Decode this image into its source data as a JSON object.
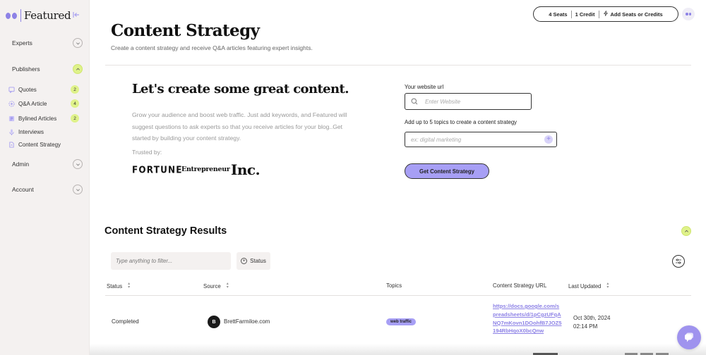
{
  "sidebar": {
    "brand": "Featured",
    "sections": [
      {
        "label": "Experts",
        "expanded": false
      },
      {
        "label": "Publishers",
        "expanded": true
      },
      {
        "label": "Admin",
        "expanded": false
      },
      {
        "label": "Account",
        "expanded": false
      }
    ],
    "publisher_items": [
      {
        "label": "Quotes",
        "icon": "quote-bubble-icon",
        "badge": "2"
      },
      {
        "label": "Q&A Article",
        "icon": "plus-circle-icon",
        "badge": "4"
      },
      {
        "label": "Bylined Articles",
        "icon": "article-icon",
        "badge": "2"
      },
      {
        "label": "Interviews",
        "icon": "microphone-icon",
        "badge": null
      },
      {
        "label": "Content Strategy",
        "icon": "document-icon",
        "badge": null
      }
    ]
  },
  "topbar": {
    "seats": "4 Seats",
    "credits": "1 Credit",
    "add_label": "Add Seats or Credits"
  },
  "header": {
    "title": "Content Strategy",
    "subtitle": "Create a content strategy and receive Q&A articles featuring expert insights."
  },
  "hero": {
    "title": "Let's create some great content.",
    "description": "Grow your audience and boost web traffic. Just add keywords, and Featured will suggest questions to ask experts so that you receive articles for your blog..Get started by building your content strategy.",
    "trusted_label": "Trusted by:",
    "logos": [
      "FORTUNE",
      "Entrepreneur",
      "Inc."
    ]
  },
  "form": {
    "website_label": "Your website url",
    "website_placeholder": "Enter Website",
    "website_value": "",
    "topics_label": "Add up to 5 topics to create a content strategy",
    "topics_placeholder": "ex: digital marketing",
    "topics_value": "",
    "submit_label": "Get Content Strategy"
  },
  "results": {
    "title": "Content Strategy Results",
    "filter_placeholder": "Type anything to filter...",
    "status_filter_label": "Status",
    "columns": [
      "Status",
      "Source",
      "Topics",
      "Content Strategy URL",
      "Last Updated"
    ],
    "rows": [
      {
        "status": "Completed",
        "source_initial": "B",
        "source": "BrettFarmiloe.com",
        "topic": "web traffic",
        "url": "https://docs.google.com/spreadsheets/d/1pCgzUFqANQ7mKovn1DOohfB7JOZ5194RbHqoX0bcQnw",
        "updated_date": "Oct 30th, 2024",
        "updated_time": "02:14 PM"
      }
    ]
  },
  "colors": {
    "accent_purple": "#a79ff5",
    "brand_purple": "#8d82e6",
    "lime": "#dff28a",
    "sidebar_bg": "#f4f1f0"
  }
}
